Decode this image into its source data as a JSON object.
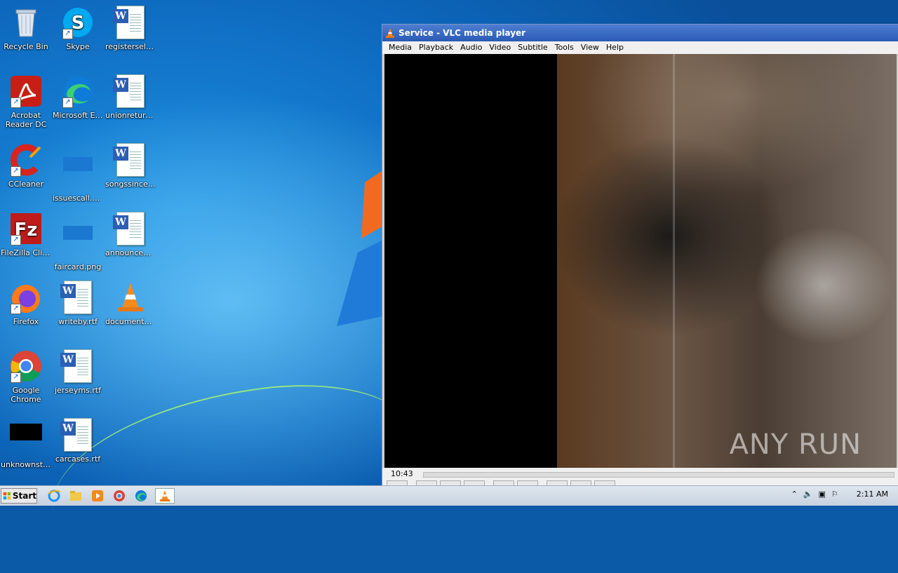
{
  "desktop": {
    "icons": [
      {
        "label": "Recycle Bin"
      },
      {
        "label": "Skype"
      },
      {
        "label": "registersell.rtf"
      },
      {
        "label": "Acrobat Reader DC"
      },
      {
        "label": "Microsoft Edge"
      },
      {
        "label": "unionreturn...."
      },
      {
        "label": "CCleaner"
      },
      {
        "label": "issuescall.png"
      },
      {
        "label": "songssince.rtf"
      },
      {
        "label": "FileZilla Client"
      },
      {
        "label": "faircard.png"
      },
      {
        "label": "announcem..."
      },
      {
        "label": "Firefox"
      },
      {
        "label": "writeby.rtf"
      },
      {
        "label": "documenta..."
      },
      {
        "label": "Google Chrome"
      },
      {
        "label": "jerseyms.rtf"
      },
      {
        "label": "unknownsta..."
      },
      {
        "label": "carcases.rtf"
      }
    ]
  },
  "vlc": {
    "title": "Service - VLC media player",
    "menu": [
      "Media",
      "Playback",
      "Audio",
      "Video",
      "Subtitle",
      "Tools",
      "View",
      "Help"
    ],
    "time": "10:43",
    "watermark": "ANY RUN"
  },
  "taskbar": {
    "start_label": "Start",
    "clock": "2:11 AM"
  },
  "colors": {
    "titlebar": "#2a5ab5",
    "desktop": "#0d68bd",
    "taskbar": "#c7d2de"
  }
}
